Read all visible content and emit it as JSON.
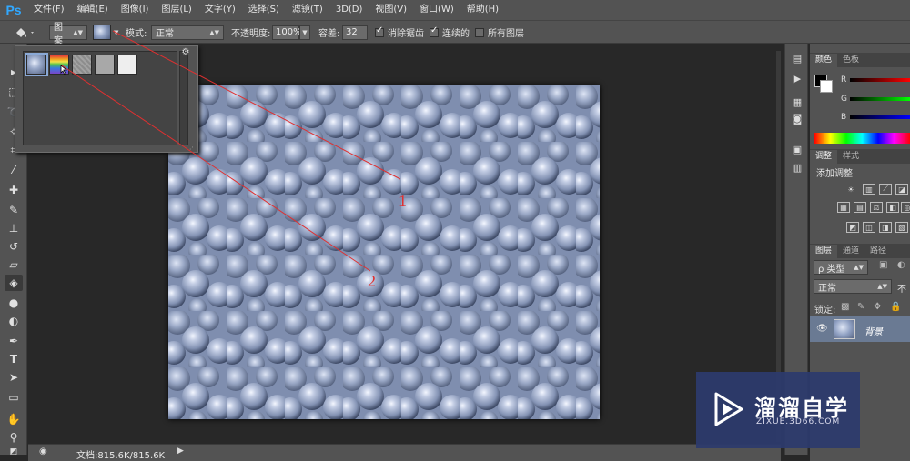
{
  "app": {
    "logo": "Ps"
  },
  "menu": [
    "文件(F)",
    "编辑(E)",
    "图像(I)",
    "图层(L)",
    "文字(Y)",
    "选择(S)",
    "滤镜(T)",
    "3D(D)",
    "视图(V)",
    "窗口(W)",
    "帮助(H)"
  ],
  "options": {
    "fill_source": "图案",
    "mode_label": "模式:",
    "mode_value": "正常",
    "opacity_label": "不透明度:",
    "opacity_value": "100%",
    "tolerance_label": "容差:",
    "tolerance_value": "32",
    "antialias_label": "消除锯齿",
    "antialias_checked": true,
    "contiguous_label": "连续的",
    "contiguous_checked": true,
    "all_layers_label": "所有图层",
    "all_layers_checked": false
  },
  "annotations": {
    "label_1": "1",
    "label_2": "2",
    "color": "#e03030"
  },
  "status": {
    "doc_info": "文档:815.6K/815.6K"
  },
  "panels": {
    "color_tabs": [
      "颜色",
      "色板"
    ],
    "rgb_labels": [
      "R",
      "G",
      "B"
    ],
    "adjust_tabs": [
      "调整",
      "样式"
    ],
    "adjust_title": "添加调整",
    "layer_tabs": [
      "图层",
      "通道",
      "路径"
    ],
    "layer_filter": "ρ 类型",
    "blend_mode": "正常",
    "opacity_short": "不",
    "lock_label": "锁定:",
    "layer_name": "背景"
  },
  "watermark": {
    "title": "溜溜自学",
    "url": "ZIXUE.3D66.COM"
  },
  "colors": {
    "panel_bg": "#535353",
    "canvas_pattern": "#8f9fbd",
    "ps_blue": "#31a8ff",
    "watermark_bg": "#2d3b6e"
  }
}
